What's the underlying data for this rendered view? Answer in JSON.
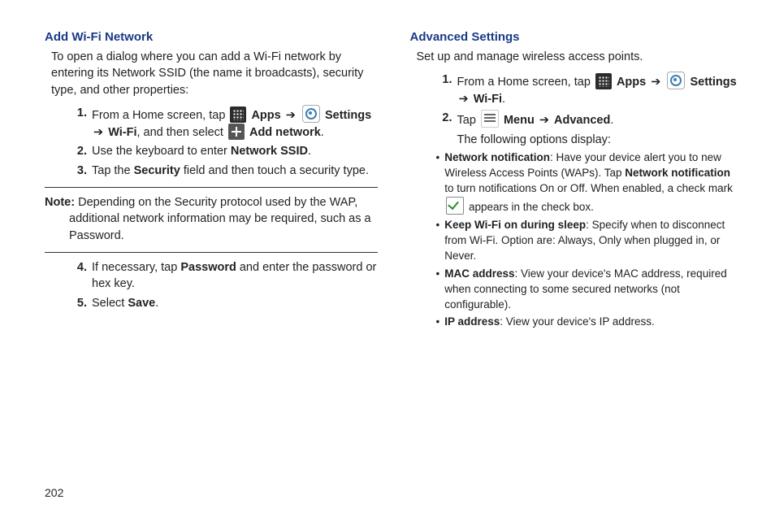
{
  "page_number": "202",
  "left": {
    "heading": "Add Wi-Fi Network",
    "intro": "To open a dialog where you can add a Wi-Fi network by entering its Network SSID (the name it broadcasts), security type, and other properties:",
    "s1": {
      "num": "1.",
      "pre": "From a Home screen, tap ",
      "apps": "Apps",
      "arrow1": "➔",
      "settings": "Settings",
      "arrow2": "➔",
      "wifi": "Wi-Fi",
      "mid": ", and then select ",
      "addnet": "Add network",
      "end": "."
    },
    "s2": {
      "num": "2.",
      "pre": "Use the keyboard to enter ",
      "ssid": "Network SSID",
      "end": "."
    },
    "s3": {
      "num": "3.",
      "pre": "Tap the ",
      "sec": "Security",
      "end": " field and then touch a security type."
    },
    "note": {
      "label": "Note:",
      "body": " Depending on the Security protocol used by the WAP, additional network information may be required, such as a Password."
    },
    "s4": {
      "num": "4.",
      "pre": "If necessary, tap ",
      "pw": "Password",
      "end": " and enter the password or hex key."
    },
    "s5": {
      "num": "5.",
      "pre": "Select ",
      "save": "Save",
      "end": "."
    }
  },
  "right": {
    "heading": "Advanced Settings",
    "intro": "Set up and manage wireless access points.",
    "s1": {
      "num": "1.",
      "pre": "From a Home screen, tap ",
      "apps": "Apps",
      "arrow1": "➔",
      "settings": "Settings",
      "arrow2": "➔",
      "wifi": "Wi-Fi",
      "end": "."
    },
    "s2": {
      "num": "2.",
      "pre": "Tap ",
      "menu": "Menu",
      "arrow": "➔",
      "adv": "Advanced",
      "end": ".",
      "follow": "The following options display:"
    },
    "b1": {
      "t1": "Network notification",
      "t2": ": Have your device alert you to new Wireless Access Points (WAPs). Tap ",
      "t3": "Network notification",
      "t4": " to turn notifications On or Off. When enabled, a check mark ",
      "t5": " appears in the check box."
    },
    "b2": {
      "t1": "Keep Wi-Fi on during sleep",
      "t2": ": Specify when to disconnect from Wi-Fi. Option are: Always, Only when plugged in, or Never."
    },
    "b3": {
      "t1": "MAC address",
      "t2": ": View your device's MAC address, required when connecting to some secured networks (not configurable)."
    },
    "b4": {
      "t1": "IP address",
      "t2": ": View your device's IP address."
    }
  }
}
